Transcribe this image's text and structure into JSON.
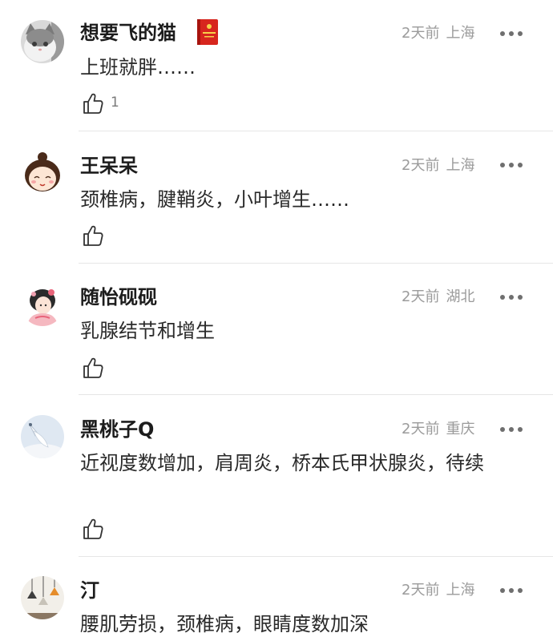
{
  "comments": [
    {
      "username": "想要飞的猫",
      "time": "2天前",
      "location": "上海",
      "text": "上班就胖……",
      "likes": "1",
      "has_badge": true
    },
    {
      "username": "王呆呆",
      "time": "2天前",
      "location": "上海",
      "text": "颈椎病，腱鞘炎，小叶增生……",
      "likes": ""
    },
    {
      "username": "随怡砚砚",
      "time": "2天前",
      "location": "湖北",
      "text": "乳腺结节和增生",
      "likes": ""
    },
    {
      "username": "黑桃子Q",
      "time": "2天前",
      "location": "重庆",
      "text": "近视度数增加，肩周炎，桥本氏甲状腺炎，待续",
      "likes": ""
    },
    {
      "username": "汀",
      "time": "2天前",
      "location": "上海",
      "text": "腰肌劳损，颈椎病，眼睛度数加深",
      "likes": ""
    }
  ],
  "icons": {
    "like": "thumbs-up-icon",
    "more": "more-dots-icon",
    "badge": "red-book-badge-icon"
  },
  "colors": {
    "meta_text": "#9b9b9b",
    "divider": "#e6e6e6",
    "badge_red": "#d7261e"
  }
}
